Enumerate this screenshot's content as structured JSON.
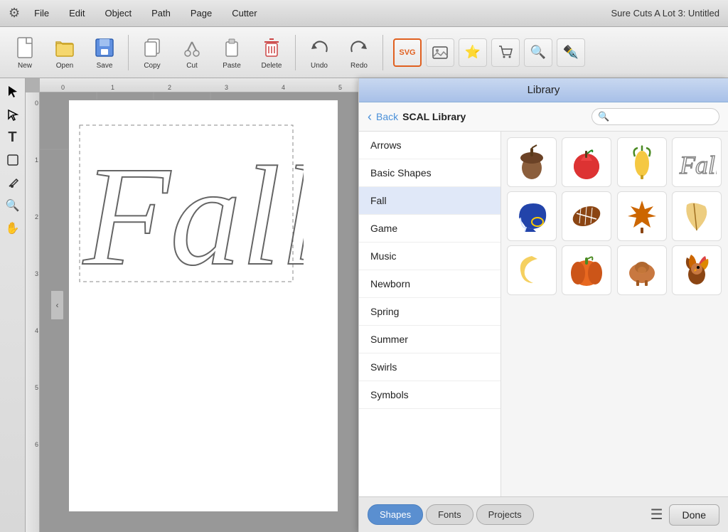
{
  "app": {
    "title": "Sure Cuts A Lot 3: Untitled",
    "gear_label": "⚙"
  },
  "menu": {
    "items": [
      "File",
      "Edit",
      "Object",
      "Path",
      "Page",
      "Cutter"
    ]
  },
  "toolbar": {
    "buttons": [
      {
        "label": "New",
        "icon": "new"
      },
      {
        "label": "Open",
        "icon": "open"
      },
      {
        "label": "Save",
        "icon": "save"
      },
      {
        "label": "Copy",
        "icon": "copy"
      },
      {
        "label": "Cut",
        "icon": "cut"
      },
      {
        "label": "Paste",
        "icon": "paste"
      },
      {
        "label": "Delete",
        "icon": "delete"
      },
      {
        "label": "Undo",
        "icon": "undo"
      },
      {
        "label": "Redo",
        "icon": "redo"
      }
    ]
  },
  "library": {
    "title": "Library",
    "back_label": "Back",
    "nav_title": "SCAL Library",
    "search_placeholder": "",
    "categories": [
      {
        "label": "Arrows",
        "active": false
      },
      {
        "label": "Basic Shapes",
        "active": false
      },
      {
        "label": "Fall",
        "active": true
      },
      {
        "label": "Game",
        "active": false
      },
      {
        "label": "Music",
        "active": false
      },
      {
        "label": "Newborn",
        "active": false
      },
      {
        "label": "Spring",
        "active": false
      },
      {
        "label": "Summer",
        "active": false
      },
      {
        "label": "Swirls",
        "active": false
      },
      {
        "label": "Symbols",
        "active": false
      }
    ],
    "footer": {
      "tabs": [
        {
          "label": "Shapes",
          "active": true
        },
        {
          "label": "Fonts",
          "active": false
        },
        {
          "label": "Projects",
          "active": false
        }
      ],
      "done_label": "Done"
    }
  },
  "canvas": {
    "zoom": 100
  }
}
